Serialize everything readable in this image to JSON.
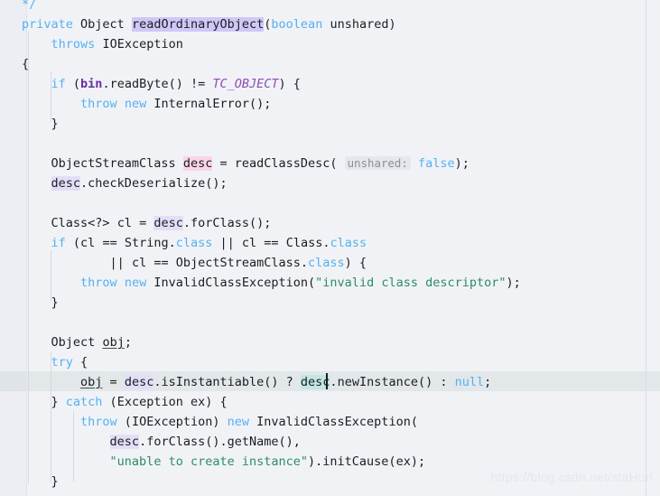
{
  "editor": {
    "language": "Java",
    "background_color": "#f1f2f6",
    "gutter_color": "#eceef3",
    "current_line_color": "#e2e7e9",
    "caret_color": "#1b1d22",
    "right_margin_guide_color": "#dcdee4",
    "caret_line_index": 18,
    "watermark": "https://blog.csdn.net/staHuri"
  },
  "palette": {
    "keyword": "#55b1f0",
    "string": "#2c8c6a",
    "plain_text": "#1b1d22",
    "field_bold": "#6a2fa0",
    "static_final_italic": "#8a4fb8",
    "comment": "#7a8a99",
    "inlay_hint_bg": "#e6e7ec",
    "inlay_hint_fg": "#8c8f99",
    "declaration_highlight": "#cfc8f7",
    "write_occurrence_highlight": "#fbd4ea",
    "read_occurrence_highlight": "#e2def8",
    "caret_word_highlight": "#c2e6e3"
  },
  "code": {
    "lines": [
      {
        "text": "     */"
      },
      {
        "text": "    private Object readOrdinaryObject(boolean unshared)"
      },
      {
        "text": "        throws IOException"
      },
      {
        "text": "    {"
      },
      {
        "text": "        if (bin.readByte() != TC_OBJECT) {"
      },
      {
        "text": "            throw new InternalError();"
      },
      {
        "text": "        }"
      },
      {
        "text": ""
      },
      {
        "text": "        ObjectStreamClass desc = readClassDesc( unshared: false);"
      },
      {
        "text": "        desc.checkDeserialize();"
      },
      {
        "text": ""
      },
      {
        "text": "        Class<?> cl = desc.forClass();"
      },
      {
        "text": "        if (cl == String.class || cl == Class.class"
      },
      {
        "text": "                || cl == ObjectStreamClass.class) {"
      },
      {
        "text": "            throw new InvalidClassException(\"invalid class descriptor\");"
      },
      {
        "text": "        }"
      },
      {
        "text": ""
      },
      {
        "text": "        Object obj;"
      },
      {
        "text": "        try {"
      },
      {
        "text": "            obj = desc.isInstantiable() ? desc.newInstance() : null;"
      },
      {
        "text": "        } catch (Exception ex) {"
      },
      {
        "text": "            throw (IOException) new InvalidClassException("
      },
      {
        "text": "                desc.forClass().getName(),"
      },
      {
        "text": "                \"unable to create instance\").initCause(ex);"
      },
      {
        "text": "        }"
      }
    ],
    "tokens": {
      "comment_close": "*/",
      "kw_private": "private",
      "type_object": "Object",
      "method_name": "readOrdinaryObject",
      "kw_boolean": "boolean",
      "param_unshared": "unshared",
      "kw_throws": "throws",
      "type_ioexception": "IOException",
      "kw_if": "if",
      "field_bin": "bin",
      "call_readbyte": "readByte",
      "const_tc_object": "TC_OBJECT",
      "kw_throw": "throw",
      "kw_new": "new",
      "type_internalerror": "InternalError",
      "type_objectstreamclass": "ObjectStreamClass",
      "var_desc": "desc",
      "call_readclassdesc": "readClassDesc",
      "inlay_unshared": "unshared:",
      "kw_false": "false",
      "call_checkdeserialize": "checkDeserialize",
      "type_class": "Class",
      "generic_wildcard": "<?>",
      "var_cl": "cl",
      "call_forclass": "forClass",
      "type_string": "String",
      "kw_class_literal": "class",
      "type_invalidclassexception": "InvalidClassException",
      "str_invalid_class_descriptor": "\"invalid class descriptor\"",
      "var_obj": "obj",
      "kw_try": "try",
      "call_isinstantiable": "isInstantiable",
      "call_newinstance": "newInstance",
      "kw_null": "null",
      "kw_catch": "catch",
      "type_exception": "Exception",
      "var_ex": "ex",
      "call_getname": "getName",
      "str_unable_to_create_instance": "\"unable to create instance\"",
      "call_initcause": "initCause"
    }
  }
}
